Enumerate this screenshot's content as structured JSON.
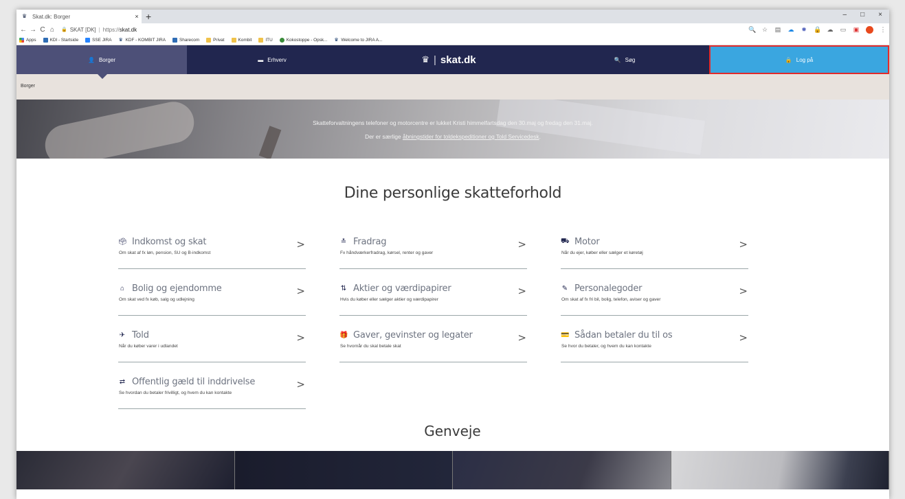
{
  "browser": {
    "tab_title": "Skat.dk: Borger",
    "tab_close": "×",
    "new_tab": "+",
    "window_controls": [
      "–",
      "□",
      "×"
    ],
    "nav": {
      "back": "←",
      "forward": "→",
      "reload": "C",
      "home": "⌂"
    },
    "url_lock": "🔒",
    "url_site": "SKAT [DK]",
    "url_sep": "|",
    "url_prefix": "https://",
    "url_host": "skat.dk",
    "extension_icons": [
      "zoom-icon",
      "star-icon",
      "ext-icon",
      "cloud-icon",
      "settings-icon",
      "lock-ext-icon",
      "onedrive-icon",
      "cast-icon",
      "photo-icon",
      "profile-icon",
      "menu-icon"
    ]
  },
  "bookmarks": [
    {
      "label": "Apps",
      "icon": "apps"
    },
    {
      "label": "KDI - Startside",
      "icon": "blue"
    },
    {
      "label": "SSE JIRA",
      "icon": "jira"
    },
    {
      "label": "KDF - KOMBIT JIRA",
      "icon": "kdf"
    },
    {
      "label": "Sharecom",
      "icon": "blue"
    },
    {
      "label": "Privat",
      "icon": "folder"
    },
    {
      "label": "Kombit",
      "icon": "folder"
    },
    {
      "label": "ITU",
      "icon": "folder"
    },
    {
      "label": "Kokostoppe - Opsk...",
      "icon": "eye"
    },
    {
      "label": "Welcome to JIRA A...",
      "icon": "kdf"
    }
  ],
  "sitenav": {
    "borger": "Borger",
    "erhverv": "Erhverv",
    "logo": "skat.dk",
    "sog": "Søg",
    "log_paa": "Log på"
  },
  "breadcrumb": "Borger",
  "hero": {
    "line1": "Skatteforvaltningens telefoner og motorcentre er lukket Kristi himmelfartsdag den 30.maj og fredag den 31.maj.",
    "line2_prefix": "Der er særlige ",
    "line2_link": "åbningstider for toldekspeditioner og Told Servicedesk",
    "line2_suffix": "."
  },
  "main": {
    "title": "Dine personlige skatteforhold",
    "cards": [
      {
        "title": "Indkomst og skat",
        "sub": "Om skat af fx løn, pension, SU og B-indkomst",
        "icon": "🗳"
      },
      {
        "title": "Fradrag",
        "sub": "Fx håndværkerfradrag, kørsel, renter og gaver",
        "icon": "≛"
      },
      {
        "title": "Motor",
        "sub": "Når du ejer, køber eller sælger et køretøj",
        "icon": "⛟"
      },
      {
        "title": "Bolig og ejendomme",
        "sub": "Om skat ved fx køb, salg og udlejning",
        "icon": "⌂"
      },
      {
        "title": "Aktier og værdipapirer",
        "sub": "Hvis du køber eller sælger aktier og værdipapirer",
        "icon": "⇅"
      },
      {
        "title": "Personalegoder",
        "sub": "Om skat af fx fri bil, bolig, telefon, aviser og gaver",
        "icon": "✎"
      },
      {
        "title": "Told",
        "sub": "Når du køber varer i udlandet",
        "icon": "✈"
      },
      {
        "title": "Gaver, gevinster og legater",
        "sub": "Se hvornår du skal betale skat",
        "icon": "🎁"
      },
      {
        "title": "Sådan betaler du til os",
        "sub": "Se hvor du betaler, og hvem du kan kontakte",
        "icon": "💳"
      },
      {
        "title": "Offentlig gæld til inddrivelse",
        "sub": "Se hvordan du betaler frivilligt, og hvem du kan kontakte",
        "icon": "⇄"
      }
    ],
    "chevron": ">"
  },
  "genveje": "Genveje"
}
